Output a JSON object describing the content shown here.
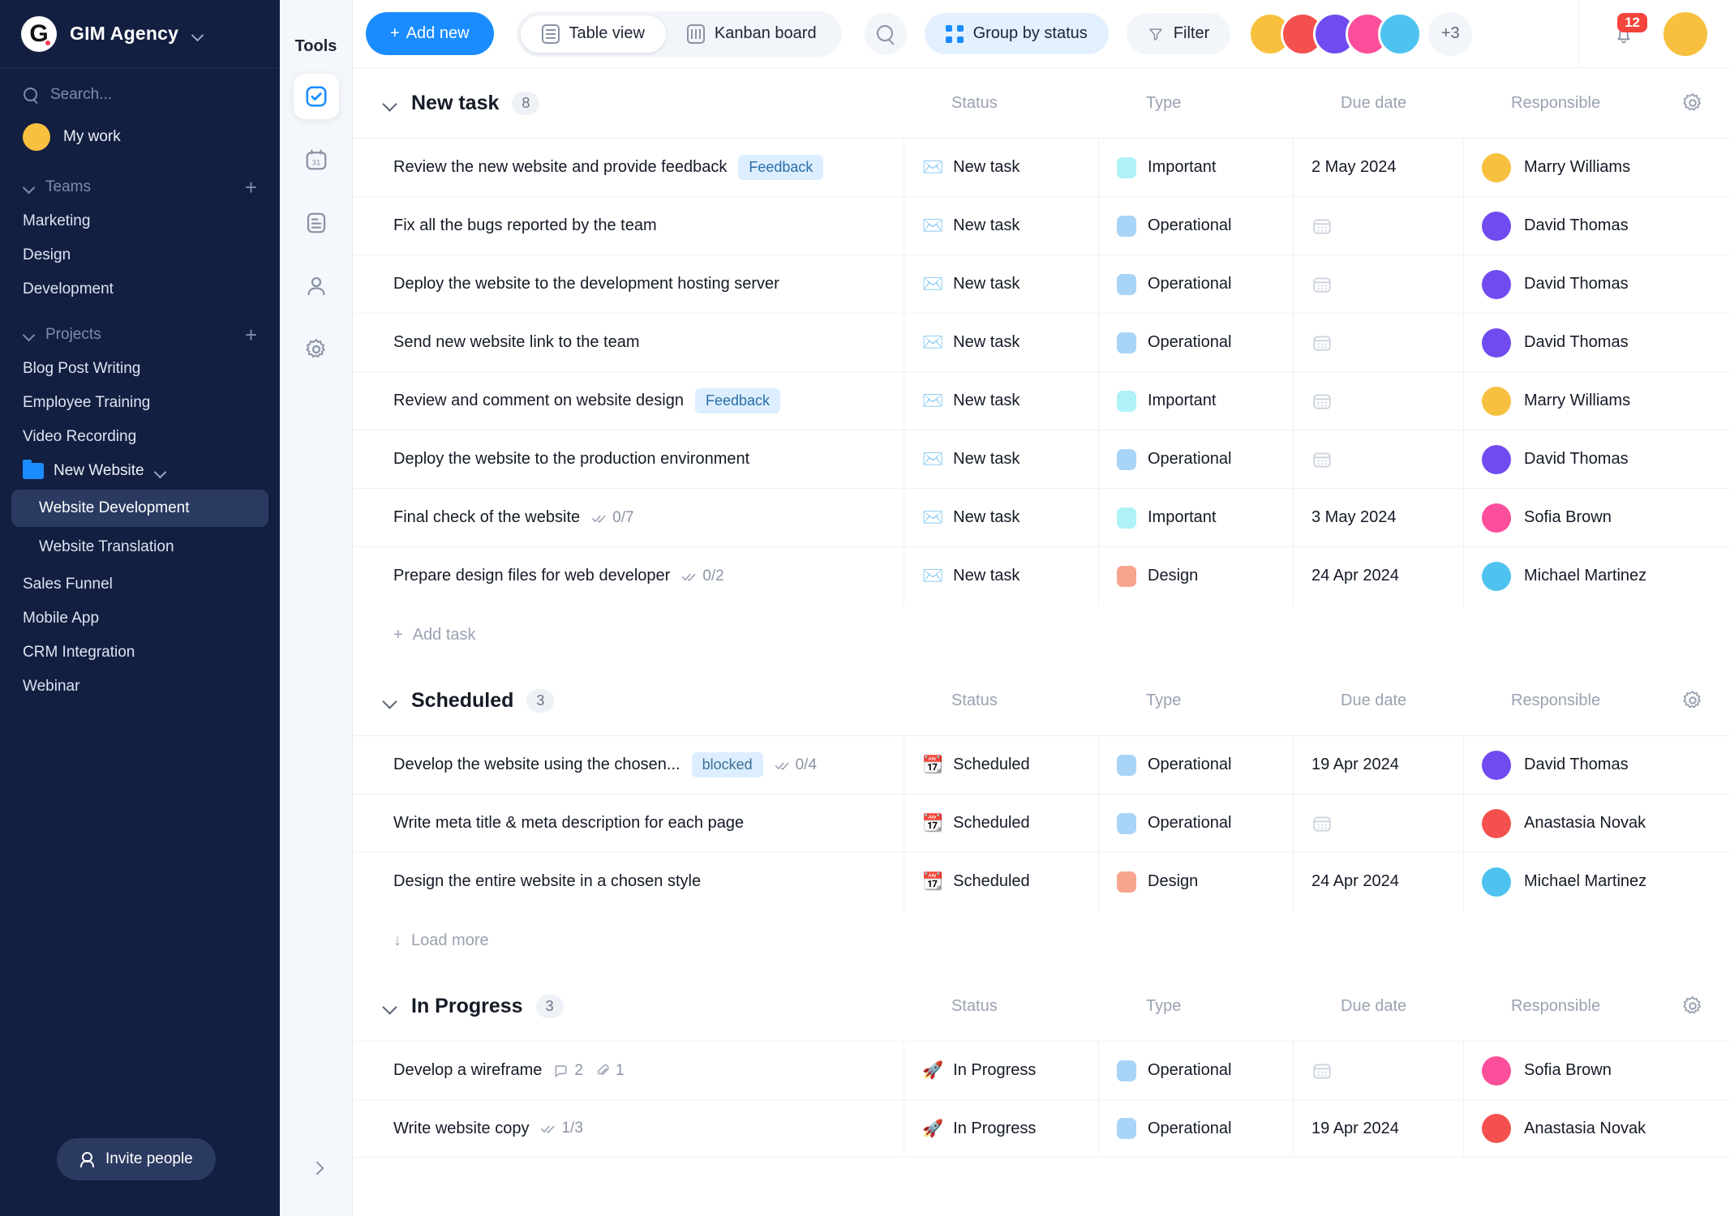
{
  "workspace": {
    "name": "GIM Agency",
    "logo_letter": "G",
    "search_placeholder": "Search...",
    "my_work_label": "My work",
    "invite_label": "Invite people"
  },
  "sidebar": {
    "teams": {
      "label": "Teams",
      "items": [
        "Marketing",
        "Design",
        "Development"
      ]
    },
    "projects": {
      "label": "Projects",
      "items": [
        "Blog Post Writing",
        "Employee Training",
        "Video Recording"
      ],
      "folder": {
        "label": "New Website",
        "children": [
          {
            "label": "Website Development",
            "active": true
          },
          {
            "label": "Website Translation",
            "active": false
          }
        ]
      },
      "items_after": [
        "Sales Funnel",
        "Mobile App",
        "CRM Integration",
        "Webinar"
      ]
    }
  },
  "rail": {
    "title": "Tools",
    "items": [
      {
        "name": "tasks-icon",
        "selected": true
      },
      {
        "name": "calendar-icon",
        "selected": false
      },
      {
        "name": "notes-icon",
        "selected": false
      },
      {
        "name": "contacts-icon",
        "selected": false
      },
      {
        "name": "settings-icon",
        "selected": false
      }
    ]
  },
  "toolbar": {
    "add_new_label": "Add new",
    "table_view_label": "Table view",
    "kanban_board_label": "Kanban board",
    "group_by_label": "Group by status",
    "filter_label": "Filter",
    "avatars_overflow": "+3",
    "notification_count": "12",
    "accent_color": "#1a8cff"
  },
  "columns": {
    "status": "Status",
    "type": "Type",
    "due_date": "Due date",
    "responsible": "Responsible"
  },
  "actions": {
    "add_task": "Add task",
    "load_more": "Load more"
  },
  "groups": [
    {
      "title": "New task",
      "count": "8",
      "footer": "add_task",
      "rows": [
        {
          "title": "Review the new website and provide feedback",
          "tag": "Feedback",
          "status": "New task",
          "status_emoji": "✉️",
          "type": "Important",
          "type_color": "#aef1f7",
          "due": "2 May 2024",
          "assignee": "Marry Williams",
          "avatar_color": "#f7c13f"
        },
        {
          "title": "Fix all the bugs reported by the team",
          "status": "New task",
          "status_emoji": "✉️",
          "type": "Operational",
          "type_color": "#a8d4f8",
          "due": "",
          "assignee": "David Thomas",
          "avatar_color": "#6f4bf0"
        },
        {
          "title": "Deploy the website to the development hosting server",
          "status": "New task",
          "status_emoji": "✉️",
          "type": "Operational",
          "type_color": "#a8d4f8",
          "due": "",
          "assignee": "David Thomas",
          "avatar_color": "#6f4bf0"
        },
        {
          "title": "Send new website link to the team",
          "status": "New task",
          "status_emoji": "✉️",
          "type": "Operational",
          "type_color": "#a8d4f8",
          "due": "",
          "assignee": "David Thomas",
          "avatar_color": "#6f4bf0"
        },
        {
          "title": "Review and comment on website design",
          "tag": "Feedback",
          "status": "New task",
          "status_emoji": "✉️",
          "type": "Important",
          "type_color": "#aef1f7",
          "due": "",
          "assignee": "Marry Williams",
          "avatar_color": "#f7c13f"
        },
        {
          "title": "Deploy the website to the production environment",
          "status": "New task",
          "status_emoji": "✉️",
          "type": "Operational",
          "type_color": "#a8d4f8",
          "due": "",
          "assignee": "David Thomas",
          "avatar_color": "#6f4bf0"
        },
        {
          "title": "Final check of the website",
          "subtasks": "0/7",
          "status": "New task",
          "status_emoji": "✉️",
          "type": "Important",
          "type_color": "#aef1f7",
          "due": "3 May 2024",
          "assignee": "Sofia Brown",
          "avatar_color": "#fb4e9b"
        },
        {
          "title": "Prepare design files for web developer",
          "subtasks": "0/2",
          "status": "New task",
          "status_emoji": "✉️",
          "type": "Design",
          "type_color": "#f7a58d",
          "due": "24 Apr 2024",
          "assignee": "Michael Martinez",
          "avatar_color": "#4fc3f0"
        }
      ]
    },
    {
      "title": "Scheduled",
      "count": "3",
      "footer": "load_more",
      "rows": [
        {
          "title": "Develop the website using the chosen...",
          "tag": "blocked",
          "subtasks": "0/4",
          "status": "Scheduled",
          "status_emoji": "📆",
          "type": "Operational",
          "type_color": "#a8d4f8",
          "due": "19 Apr 2024",
          "assignee": "David Thomas",
          "avatar_color": "#6f4bf0"
        },
        {
          "title": "Write meta title & meta description for each page",
          "status": "Scheduled",
          "status_emoji": "📆",
          "type": "Operational",
          "type_color": "#a8d4f8",
          "due": "",
          "assignee": "Anastasia Novak",
          "avatar_color": "#f4514e"
        },
        {
          "title": "Design the entire website in a chosen style",
          "status": "Scheduled",
          "status_emoji": "📆",
          "type": "Design",
          "type_color": "#f7a58d",
          "due": "24 Apr 2024",
          "assignee": "Michael Martinez",
          "avatar_color": "#4fc3f0"
        }
      ]
    },
    {
      "title": "In Progress",
      "count": "3",
      "footer": "",
      "rows": [
        {
          "title": "Develop a wireframe",
          "comments": "2",
          "attachments": "1",
          "status": "In Progress",
          "status_emoji": "🚀",
          "type": "Operational",
          "type_color": "#a8d4f8",
          "due": "",
          "assignee": "Sofia Brown",
          "avatar_color": "#fb4e9b"
        },
        {
          "title": "Write website copy",
          "subtasks": "1/3",
          "status": "In Progress",
          "status_emoji": "🚀",
          "type": "Operational",
          "type_color": "#a8d4f8",
          "due": "19 Apr 2024",
          "assignee": "Anastasia Novak",
          "avatar_color": "#f4514e"
        }
      ]
    }
  ],
  "header_avatar_colors": [
    "#f7c13f",
    "#f4514e",
    "#6f4bf0",
    "#fb4e9b",
    "#4fc3f0"
  ]
}
